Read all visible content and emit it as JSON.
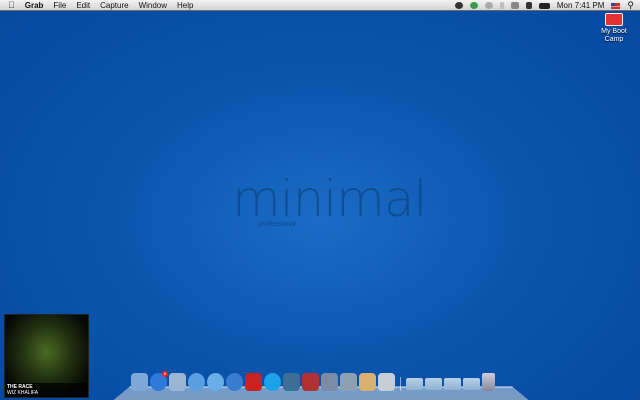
{
  "menubar": {
    "app": "Grab",
    "items": [
      "File",
      "Edit",
      "Capture",
      "Window",
      "Help"
    ],
    "clock": "Mon 7:41 PM"
  },
  "desktop": {
    "bootcamp_label": "My Boot Camp",
    "wallpaper_logo": "minimal",
    "wallpaper_sub": "professional"
  },
  "now_playing": {
    "title": "THE RACE",
    "artist": "WIZ KHALIFA"
  },
  "dock": {
    "apps": [
      {
        "name": "finder",
        "color": "#7fa8d8"
      },
      {
        "name": "app-store",
        "color": "#2e7ad6",
        "badge": "8"
      },
      {
        "name": "mail",
        "color": "#9bb5d4"
      },
      {
        "name": "safari",
        "color": "#5aa0e0"
      },
      {
        "name": "ichat",
        "color": "#6aaee8"
      },
      {
        "name": "itunes",
        "color": "#3a7cd0"
      },
      {
        "name": "photo-booth",
        "color": "#c8231e"
      },
      {
        "name": "skype",
        "color": "#1aa3e8"
      },
      {
        "name": "printer",
        "color": "#3d6f95"
      },
      {
        "name": "dictionary",
        "color": "#b33030"
      },
      {
        "name": "instruments",
        "color": "#7b8aa5"
      },
      {
        "name": "iphoto",
        "color": "#8fa0b0"
      },
      {
        "name": "notes",
        "color": "#d8b070"
      },
      {
        "name": "textedit",
        "color": "#c8ced8"
      }
    ],
    "folders": [
      "applications",
      "documents",
      "downloads",
      "desktop"
    ],
    "trash": "trash"
  },
  "colors": {
    "desktop": "#0b55ad"
  }
}
